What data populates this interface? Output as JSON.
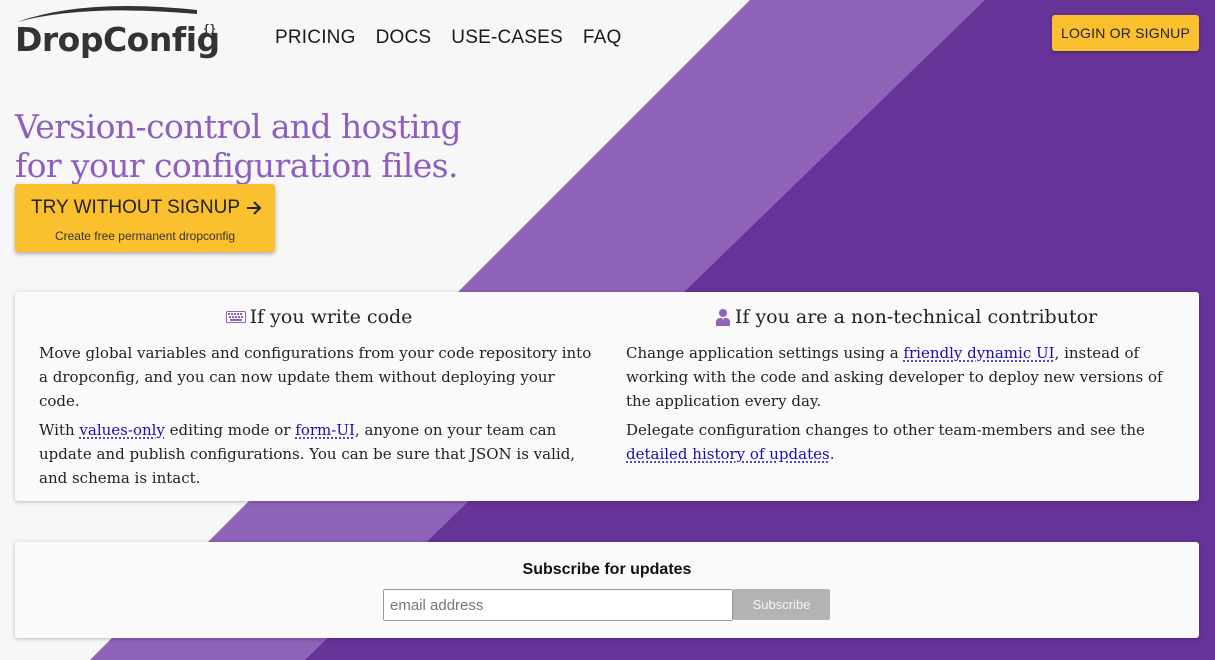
{
  "brand": {
    "name": "DropConfig",
    "mark": "{}"
  },
  "nav": {
    "items": [
      "PRICING",
      "DOCS",
      "USE-CASES",
      "FAQ"
    ],
    "login_label": "LOGIN OR SIGNUP"
  },
  "hero": {
    "title_line1": "Version-control and hosting",
    "title_line2": "for your configuration files.",
    "cta_label": "TRY WITHOUT SIGNUP",
    "cta_icon": "arrow-right-icon",
    "cta_sub": "Create free permanent dropconfig"
  },
  "features": {
    "developer": {
      "icon": "keyboard-icon",
      "title": "If you write code",
      "p1": "Move global variables and configurations from your code repository into a dropconfig, and you can now update them without deploying your code.",
      "p2_pre": "With ",
      "p2_link1": "values-only",
      "p2_mid": " editing mode or ",
      "p2_link2": "form-UI",
      "p2_post": ", anyone on your team can update and publish configurations. You can be sure that JSON is valid, and schema is intact."
    },
    "nontech": {
      "icon": "person-icon",
      "title": "If you are a non-technical contributor",
      "p1_pre": "Change application settings using a ",
      "p1_link": "friendly dynamic UI",
      "p1_post": ", instead of working with the code and asking developer to deploy new versions of the application every day.",
      "p2_pre": "Delegate configuration changes to other team-members and see the ",
      "p2_link": "detailed history of updates",
      "p2_post": "."
    }
  },
  "subscribe": {
    "title": "Subscribe for updates",
    "placeholder": "email address",
    "button_label": "Subscribe"
  },
  "colors": {
    "accent_yellow": "#fbc02d",
    "purple_light": "#8e63b8",
    "purple_dark": "#663399",
    "title_purple": "#8e5fbf",
    "link_blue": "#1a0dab"
  }
}
